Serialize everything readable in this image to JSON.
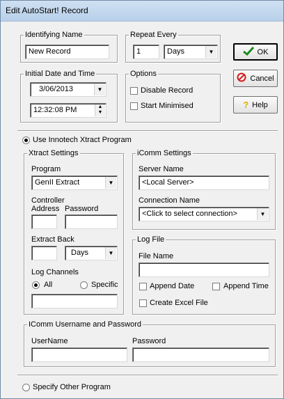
{
  "window": {
    "title": "Edit AutoStart! Record"
  },
  "identifying": {
    "legend": "Identifying Name",
    "value": "New Record"
  },
  "repeat": {
    "legend": "Repeat Every",
    "number": "1",
    "unit": "Days"
  },
  "buttons": {
    "ok": "OK",
    "cancel": "Cancel",
    "help": "Help"
  },
  "initial": {
    "legend": "Initial Date and Time",
    "date": "3/06/2013",
    "time": "12:32:08 PM"
  },
  "options": {
    "legend": "Options",
    "disable": "Disable Record",
    "start_min": "Start Minimised"
  },
  "use_innotech": "Use Innotech Xtract Program",
  "xtract": {
    "legend": "Xtract Settings",
    "program_label": "Program",
    "program_value": "GenII Extract",
    "controller_label_1": "Controller",
    "controller_label_2": "Address",
    "password_label": "Password",
    "extract_back_label": "Extract Back",
    "extract_unit": "Days",
    "log_channels_label": "Log Channels",
    "all": "All",
    "specific": "Specific"
  },
  "icomm": {
    "legend": "iComm Settings",
    "server_label": "Server Name",
    "server_value": "<Local Server>",
    "connection_label": "Connection Name",
    "connection_value": "<Click to select connection>"
  },
  "logfile": {
    "legend": "Log File",
    "file_label": "File Name",
    "append_date": "Append Date",
    "append_time": "Append Time",
    "create_excel": "Create Excel File"
  },
  "credentials": {
    "legend": "IComm Username and Password",
    "user_label": "UserName",
    "password_label": "Password"
  },
  "specify_other": "Specify Other Program",
  "colors": {
    "title_bar": "#c4d8ee",
    "dialog": "#f0f0f0",
    "ok_check": "#1c8a1c",
    "cancel_icon": "#d42020",
    "help_icon": "#e0b000"
  }
}
